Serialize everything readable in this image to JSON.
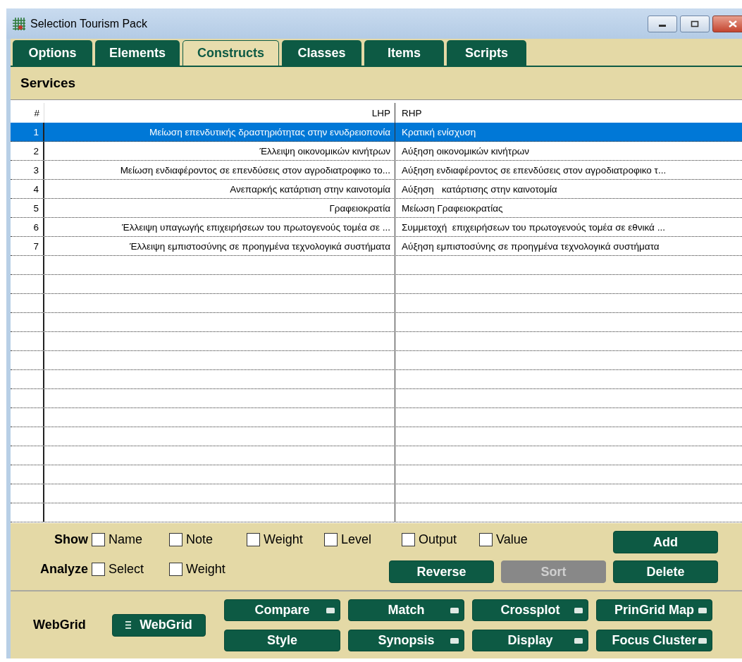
{
  "window": {
    "title": "Selection Tourism Pack"
  },
  "tabs": [
    {
      "label": "Options",
      "selected": false
    },
    {
      "label": "Elements",
      "selected": false
    },
    {
      "label": "Constructs",
      "selected": true
    },
    {
      "label": "Classes",
      "selected": false
    },
    {
      "label": "Items",
      "selected": false
    },
    {
      "label": "Scripts",
      "selected": false
    }
  ],
  "section_title": "Services",
  "table": {
    "columns": [
      "#",
      "LHP",
      "RHP"
    ],
    "rows": [
      {
        "number": "1",
        "lhp": "Μείωση επενδυτικής δραστηριότητας στην ενυδρειοπονία",
        "rhp": "Κρατική ενίσχυση",
        "selected": true
      },
      {
        "number": "2",
        "lhp": "Έλλειψη οικονομικών κινήτρων",
        "rhp": "Αύξηση οικονομικών κινήτρων",
        "selected": false
      },
      {
        "number": "3",
        "lhp": "Μείωση ενδιαφέροντος σε επενδύσεις στον αγροδιατροφικο το...",
        "rhp": "Αύξηση ενδιαφέροντος σε επενδύσεις στον αγροδιατροφικο τ...",
        "selected": false
      },
      {
        "number": "4",
        "lhp": "Ανεπαρκής κατάρτιση στην καινοτομία",
        "rhp": "Αύξηση   κατάρτισης στην καινοτομία",
        "selected": false
      },
      {
        "number": "5",
        "lhp": "Γραφειοκρατία",
        "rhp": "Μείωση Γραφειοκρατίας",
        "selected": false
      },
      {
        "number": "6",
        "lhp": "Έλλειψη υπαγωγής επιχειρήσεων του πρωτογενούς τομέα σε ...",
        "rhp": "Συμμετοχή  επιχειρήσεων του πρωτογενούς τομέα σε εθνικά ...",
        "selected": false
      },
      {
        "number": "7",
        "lhp": "Έλλειψη εμπιστοσύνης σε προηγμένα τεχνολογικά συστήματα",
        "rhp": "Αύξηση εμπιστοσύνης σε προηγμένα τεχνολογικά συστήματα",
        "selected": false
      }
    ]
  },
  "show": {
    "label": "Show",
    "options": [
      {
        "label": "Name",
        "checked": false
      },
      {
        "label": "Note",
        "checked": false
      },
      {
        "label": "Weight",
        "checked": false
      },
      {
        "label": "Level",
        "checked": false
      },
      {
        "label": "Output",
        "checked": false
      },
      {
        "label": "Value",
        "checked": false
      }
    ]
  },
  "analyze": {
    "label": "Analyze",
    "options": [
      {
        "label": "Select",
        "checked": false
      },
      {
        "label": "Weight",
        "checked": false
      }
    ]
  },
  "actions": [
    {
      "label": "Add",
      "disabled": false
    },
    {
      "label": "Reverse",
      "disabled": false
    },
    {
      "label": "Sort",
      "disabled": true
    },
    {
      "label": "Delete",
      "disabled": false
    }
  ],
  "webgrid": {
    "label": "WebGrid",
    "button": "WebGrid",
    "tools": [
      {
        "label": "Compare",
        "menu": true
      },
      {
        "label": "Match",
        "menu": true
      },
      {
        "label": "Crossplot",
        "menu": true
      },
      {
        "label": "PrinGrid Map",
        "menu": true
      },
      {
        "label": "Style",
        "menu": false
      },
      {
        "label": "Synopsis",
        "menu": true
      },
      {
        "label": "Display",
        "menu": true
      },
      {
        "label": "Focus Cluster",
        "menu": true
      }
    ]
  }
}
